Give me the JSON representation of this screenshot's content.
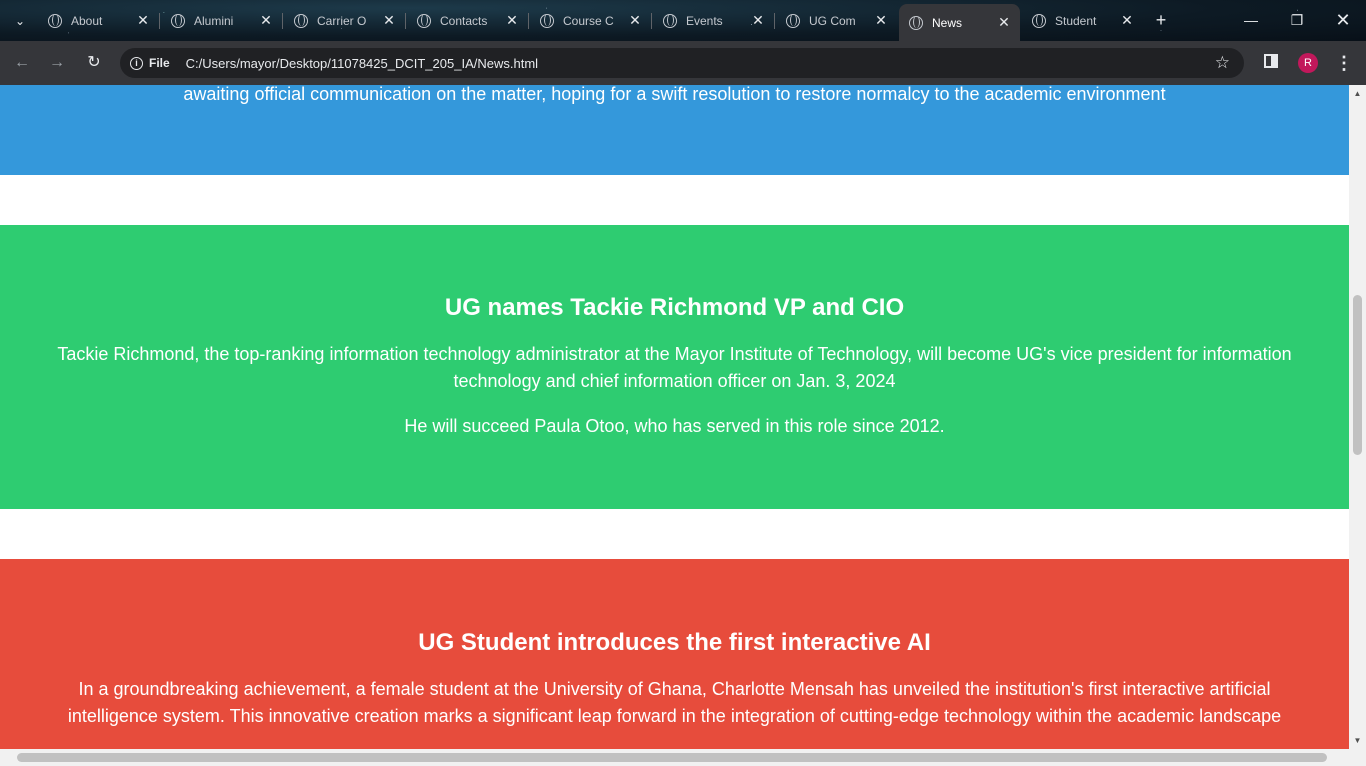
{
  "browser": {
    "tabs": [
      {
        "title": "About",
        "active": false
      },
      {
        "title": "Alumini",
        "active": false
      },
      {
        "title": "Carrier O",
        "active": false
      },
      {
        "title": "Contacts",
        "active": false
      },
      {
        "title": "Course C",
        "active": false
      },
      {
        "title": "Events",
        "active": false
      },
      {
        "title": "UG Com",
        "active": false
      },
      {
        "title": "News",
        "active": true
      },
      {
        "title": "Student",
        "active": false
      }
    ],
    "site_chip": "File",
    "url": "C:/Users/mayor/Desktop/11078425_DCIT_205_IA/News.html",
    "profile_initial": "R"
  },
  "page": {
    "news_blue": {
      "text": "awaiting official communication on the matter, hoping for a swift resolution to restore normalcy to the academic environment",
      "color": "#3498db"
    },
    "news_green": {
      "title": "UG names Tackie Richmond VP and CIO",
      "paragraph1": "Tackie Richmond, the top-ranking information technology administrator at the Mayor Institute of Technology, will become UG's vice president for information technology and chief information officer on Jan. 3, 2024",
      "paragraph2": "He will succeed Paula Otoo, who has served in this role since 2012.",
      "color": "#2ecc71"
    },
    "news_red": {
      "title": "UG Student introduces the first interactive AI",
      "paragraph": "In a groundbreaking achievement, a female student at the University of Ghana, Charlotte Mensah has unveiled the institution's first interactive artificial intelligence system. This innovative creation marks a significant leap forward in the integration of cutting-edge technology within the academic landscape",
      "color": "#e74c3c"
    }
  }
}
